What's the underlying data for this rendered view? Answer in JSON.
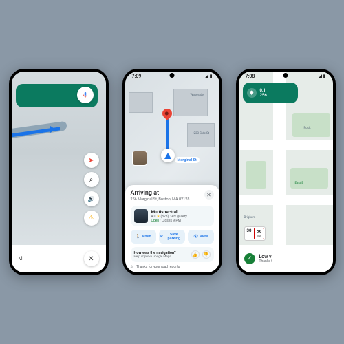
{
  "status": {
    "time_center": "7:09",
    "time_right": "7:08"
  },
  "left_phone": {
    "buttons": {
      "compass": "➤",
      "search": "⌕",
      "sound": "🔊",
      "warn": "⚠",
      "close": "✕"
    },
    "eta_suffix": "M"
  },
  "center_phone": {
    "street_label": "Marginal St",
    "map_labels": {
      "wakeside": "Wakeside",
      "side_st": "233 Side St"
    },
    "sheet": {
      "title": "Arriving at",
      "address": "256 Marginal St, Boston, MA 02128",
      "place": {
        "name": "Multispectral",
        "rating": "4.0",
        "stars": "★",
        "reviews": "(823)",
        "category": "Art gallery",
        "open": "Open",
        "closes": "· Closes 9 PM"
      },
      "chips": {
        "walk_icon": "🚶",
        "walk": "4 min",
        "park_icon": "P",
        "park": "Save parking",
        "view_icon": "👁",
        "view": "View"
      },
      "feedback": {
        "q": "How was the navigation?",
        "sub": "Help improve Google Maps",
        "up": "👍",
        "down": "👎"
      },
      "thanks": {
        "icon": "⚠",
        "text": "Thanks for your road reports"
      },
      "close": "✕"
    }
  },
  "right_phone": {
    "hud": {
      "dist": "0.1",
      "num": "256"
    },
    "map_labels": {
      "brigham": "Brigham",
      "rock": "Rock",
      "east": "East B"
    },
    "speed": {
      "current": "30",
      "limit": "29",
      "unit": "mph"
    },
    "bottom": {
      "check": "✓",
      "title": "Low v",
      "sub": "Thanks f"
    }
  }
}
